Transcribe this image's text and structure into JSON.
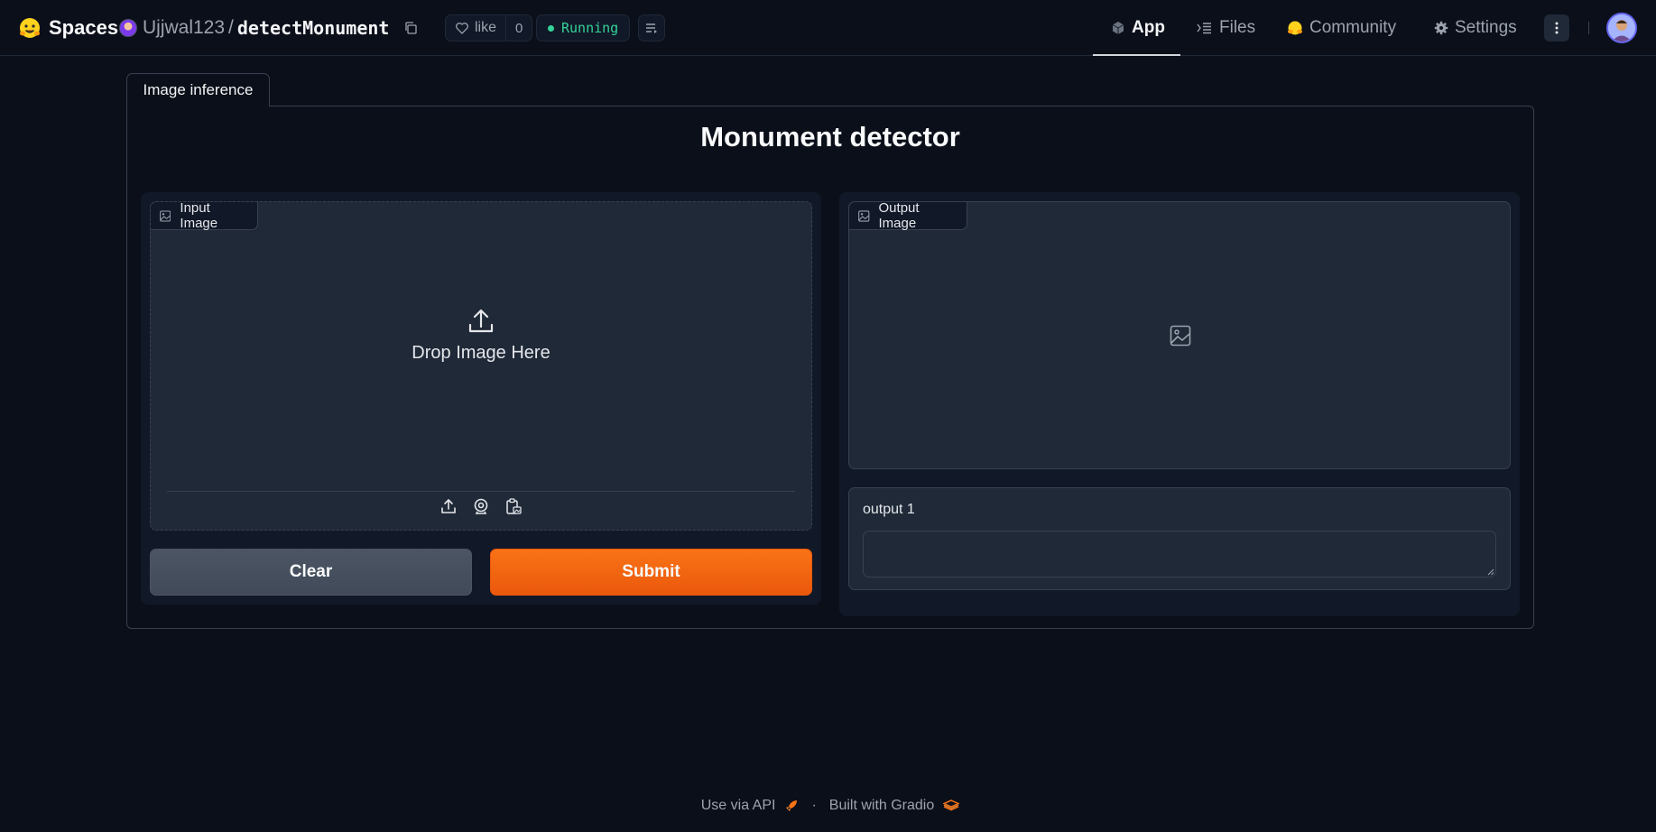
{
  "header": {
    "brand": "Spaces",
    "owner": "Ujjwal123",
    "separator": "/",
    "space_name": "detectMonument",
    "like_label": "like",
    "like_count": "0",
    "status": "Running",
    "nav": {
      "app": "App",
      "files": "Files",
      "community": "Community",
      "settings": "Settings"
    }
  },
  "main": {
    "tab_label": "Image inference",
    "title": "Monument detector",
    "input": {
      "label": "Input Image",
      "drop_text": "Drop Image Here"
    },
    "output": {
      "image_label": "Output Image",
      "text_label": "output 1",
      "text_value": ""
    },
    "buttons": {
      "clear": "Clear",
      "submit": "Submit"
    }
  },
  "footer": {
    "api": "Use via API",
    "dot": "·",
    "built": "Built with Gradio"
  },
  "colors": {
    "background": "#0b0f19",
    "panel": "#111827",
    "block": "#1f2937",
    "accent": "#f97316",
    "running": "#34d399"
  }
}
